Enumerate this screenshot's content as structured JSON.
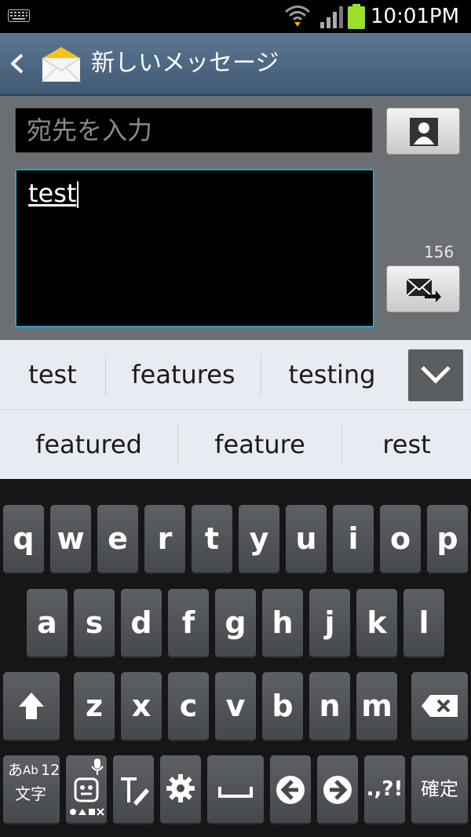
{
  "status_bar": {
    "time": "10:01PM"
  },
  "action_bar": {
    "title": "新しいメッセージ"
  },
  "compose": {
    "recipient_placeholder": "宛先を入力",
    "message_text": "test",
    "char_counter": "156"
  },
  "suggestions": {
    "row1": [
      "test",
      "features",
      "testing"
    ],
    "row2": [
      "featured",
      "feature",
      "rest"
    ]
  },
  "keyboard": {
    "row1": [
      "q",
      "w",
      "e",
      "r",
      "t",
      "y",
      "u",
      "i",
      "o",
      "p"
    ],
    "row2": [
      "a",
      "s",
      "d",
      "f",
      "g",
      "h",
      "j",
      "k",
      "l"
    ],
    "row3": [
      "z",
      "x",
      "c",
      "v",
      "b",
      "n",
      "m"
    ],
    "mode_key": {
      "top": "あ",
      "mid": "Ab",
      "num": "12",
      "bottom": "文字"
    },
    "symbols_key": ".,?!",
    "enter_key": "確定"
  }
}
